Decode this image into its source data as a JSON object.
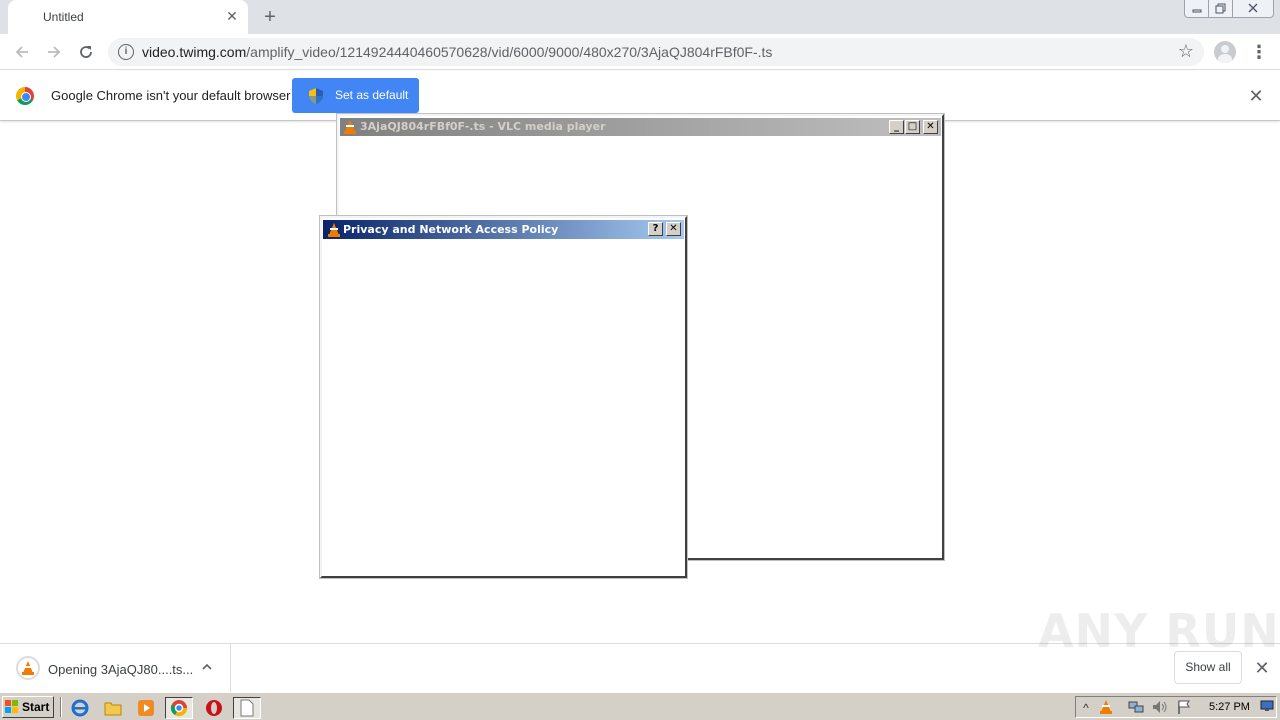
{
  "browser": {
    "tab_title": "Untitled",
    "tab_close": "✕",
    "new_tab": "+",
    "url_host": "video.twimg.com",
    "url_path": "/amplify_video/1214924440460570628/vid/6000/9000/480x270/3AjaQJ804rFBf0F-.ts",
    "infobar_message": "Google Chrome isn't your default browser",
    "set_default_label": "Set as default",
    "infobar_close": "✕"
  },
  "vlc_window": {
    "title": "3AjaQJ804rFBf0F-.ts - VLC media player",
    "min": "_",
    "max": "□",
    "close": "✕"
  },
  "privacy_dialog": {
    "title": "Privacy and Network Access Policy",
    "help": "?",
    "close": "✕"
  },
  "downloads": {
    "item_name": "Opening 3AjaQJ80....ts...",
    "chevron": "^",
    "show_all": "Show all",
    "close": "✕"
  },
  "watermark": "ANY RUN",
  "taskbar": {
    "start_label": "Start",
    "tray_chevron": "^",
    "clock": "5:27 PM"
  },
  "colors": {
    "chrome_blue": "#4285f4",
    "vlc_orange": "#f07c00",
    "dialog_title_start": "#0a246a",
    "dialog_title_end": "#a6caf0"
  }
}
